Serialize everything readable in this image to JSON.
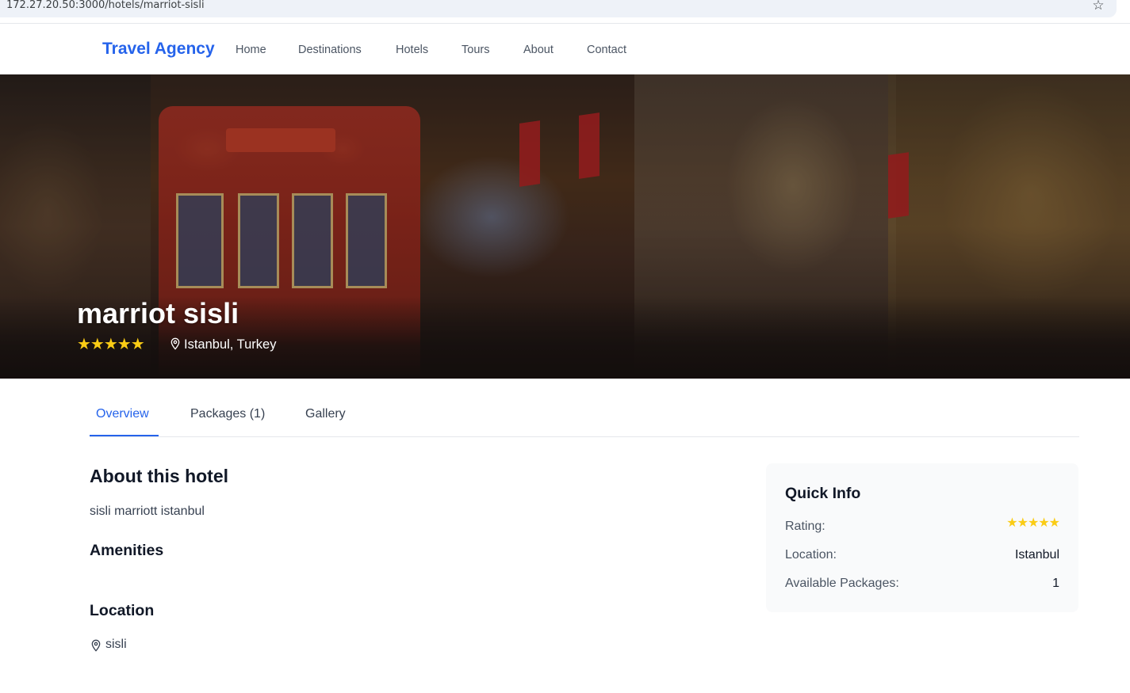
{
  "browser": {
    "url": "172.27.20.50:3000/hotels/marriot-sisli",
    "bookmark_icon": "star-outline-icon"
  },
  "nav": {
    "brand": "Travel Agency",
    "links": [
      "Home",
      "Destinations",
      "Hotels",
      "Tours",
      "About",
      "Contact"
    ]
  },
  "hero": {
    "title": "marriot sisli",
    "stars": "★★★★★",
    "rating": 5,
    "location": "Istanbul, Turkey",
    "location_icon": "map-pin-icon"
  },
  "tabs": {
    "items": [
      "Overview",
      "Packages (1)",
      "Gallery"
    ],
    "active": "Overview"
  },
  "about": {
    "heading": "About this hotel",
    "description": "sisli marriott istanbul",
    "amenities_heading": "Amenities",
    "location_heading": "Location",
    "address": "sisli",
    "address_icon": "map-pin-icon"
  },
  "quick_info": {
    "title": "Quick Info",
    "rating_label": "Rating:",
    "rating_stars": "★★★★★",
    "rating": 5,
    "location_label": "Location:",
    "location_value": "Istanbul",
    "packages_label": "Available Packages:",
    "packages_value": "1"
  },
  "colors": {
    "brand": "#2563eb",
    "star": "#facc15",
    "card_bg": "#f9fafb"
  }
}
